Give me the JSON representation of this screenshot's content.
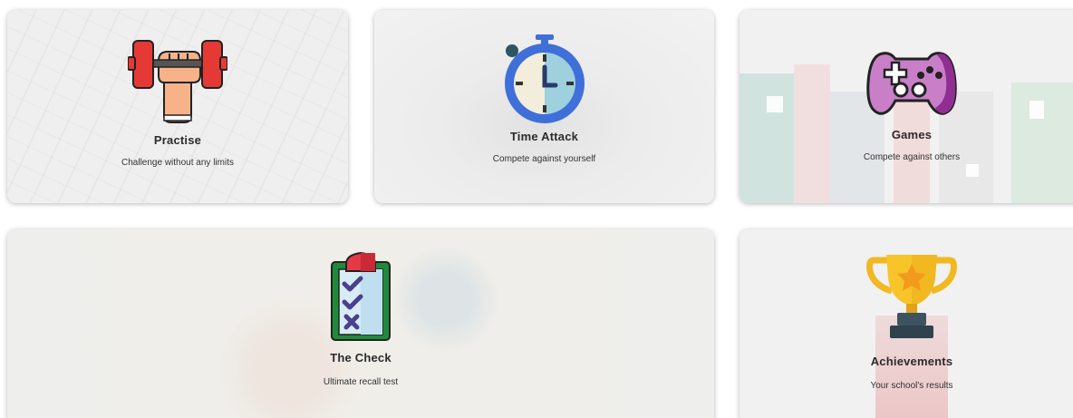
{
  "cards": [
    {
      "id": "practise",
      "title": "Practise",
      "subtitle": "Challenge without any limits",
      "icon": "dumbbell-icon"
    },
    {
      "id": "time_attack",
      "title": "Time Attack",
      "subtitle": "Compete against yourself",
      "icon": "stopwatch-icon"
    },
    {
      "id": "games",
      "title": "Games",
      "subtitle": "Compete against others",
      "icon": "gamepad-icon"
    },
    {
      "id": "check",
      "title": "The Check",
      "subtitle": "Ultimate recall test",
      "icon": "clipboard-checklist-icon"
    },
    {
      "id": "achievements",
      "title": "Achievements",
      "subtitle": "Your school's results",
      "icon": "trophy-icon"
    }
  ],
  "colors": {
    "title": "#2b2b2b",
    "dumbbell_red": "#e53935",
    "stopwatch_blue": "#3f6fd8",
    "gamepad_purple": "#a24ba8",
    "trophy_gold": "#f7c52a",
    "clipboard_green": "#1f8a3a"
  }
}
